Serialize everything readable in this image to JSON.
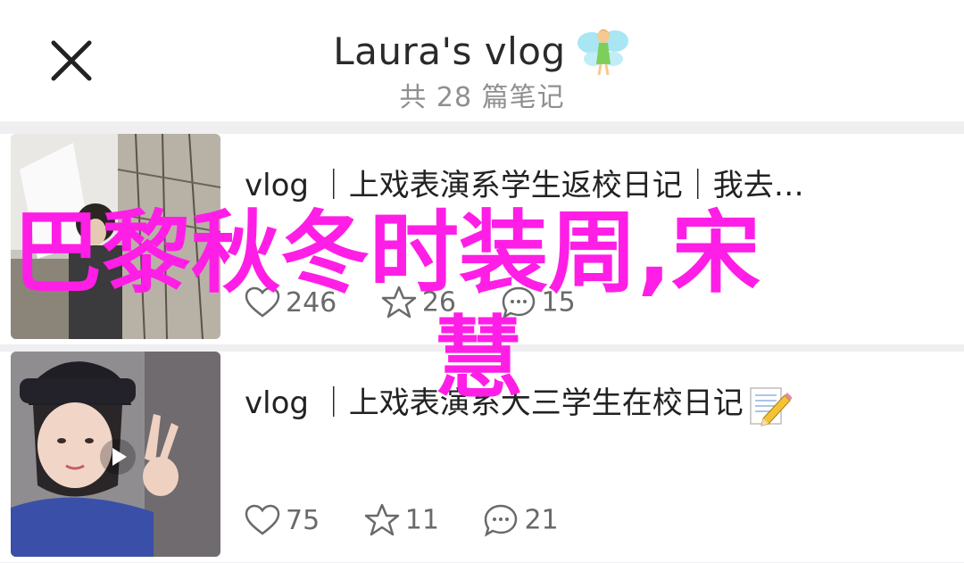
{
  "header": {
    "title": "Laura's vlog",
    "subtitle": "共 28 篇笔记",
    "close_icon": "close-icon",
    "title_decoration_icon": "fairy-emoji-icon"
  },
  "posts": [
    {
      "title": "vlog ｜上戏表演系学生返校日记｜我去…",
      "likes": "246",
      "favorites": "26",
      "comments": "15",
      "video": false
    },
    {
      "title": "vlog ｜上戏表演系大三学生在校日记",
      "title_icon": "memo-pencil-icon",
      "likes": "75",
      "favorites": "11",
      "comments": "21",
      "video": true
    }
  ],
  "overlay": {
    "line1": "巴黎秋冬时装周,宋",
    "line2": "慧",
    "color": "#ff1ee6"
  },
  "colors": {
    "background": "#efeff1",
    "card": "#ffffff",
    "text_primary": "#222222",
    "text_secondary": "#8f8f8f"
  }
}
